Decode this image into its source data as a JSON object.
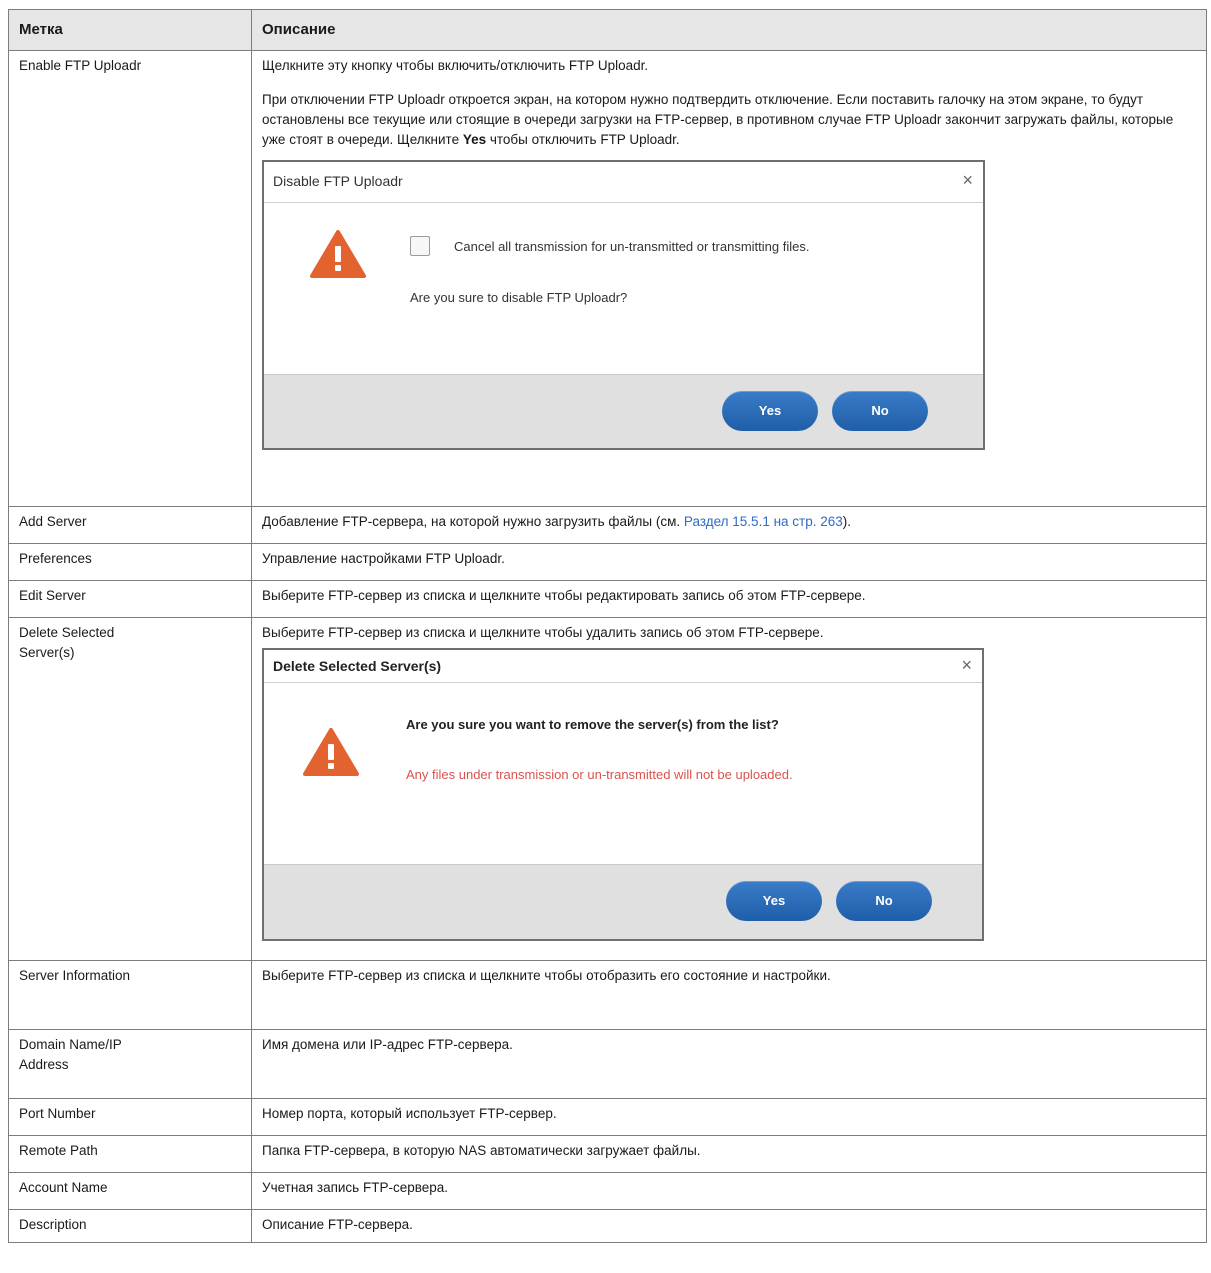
{
  "header": {
    "col_label": "Метка",
    "col_desc": "Описание"
  },
  "rows": {
    "enable": {
      "label": "Enable FTP Uploadr",
      "p1": "Щелкните эту кнопку чтобы включить/отключить  FTP Uploadr.",
      "p2_before": "При отключении FTP Uploadr откроется экран, на котором нужно подтвердить отключение. Если поставить галочку на этом экране, то будут остановлены все текущие или стоящие в очереди загрузки на FTP-сервер, в противном случае FTP Uploadr закончит загружать файлы, которые уже стоят в очереди. Щелкните ",
      "p2_bold": "Yes",
      "p2_after": " чтобы отключить FTP Uploadr."
    },
    "add": {
      "label": "Add Server",
      "text_before": "Добавление FTP-сервера, на которой нужно загрузить файлы (см. ",
      "link": "Раздел 15.5.1 на стр. 263",
      "text_after": ")."
    },
    "prefs": {
      "label": "Preferences",
      "text": "Управление настройками FTP Uploadr."
    },
    "edit": {
      "label": "Edit Server",
      "text": "Выберите FTP-сервер из списка и щелкните чтобы редактировать запись об этом FTP-сервере."
    },
    "delete": {
      "label": "Delete Selected Server(s)",
      "text": "Выберите FTP-сервер из списка и щелкните чтобы удалить запись об этом FTP-сервере."
    },
    "info": {
      "label": "Server Information",
      "text": "Выберите FTP-сервер из списка и щелкните чтобы отобразить его состояние и настройки."
    },
    "domain": {
      "label": "Domain Name/IP Address",
      "text": "Имя домена или IP-адрес FTP-сервера."
    },
    "port": {
      "label": "Port Number",
      "text": "Номер порта, который использует FTP-сервер."
    },
    "path": {
      "label": "Remote Path",
      "text": "Папка FTP-сервера, в которую NAS автоматически  загружает файлы."
    },
    "account": {
      "label": "Account Name",
      "text": "Учетная запись FTP-сервера."
    },
    "desc": {
      "label": "Description",
      "text": "Описание FTP-сервера."
    }
  },
  "dialog_disable": {
    "title": "Disable FTP Uploadr",
    "close": "×",
    "checkbox_label": "Cancel all transmission for un-transmitted or transmitting files.",
    "question": "Are you sure to disable FTP Uploadr?",
    "yes": "Yes",
    "no": "No",
    "icon": "warning-icon"
  },
  "dialog_delete": {
    "title": "Delete Selected Server(s)",
    "close": "×",
    "question": "Are you sure you want to remove the server(s) from the list?",
    "warning": "Any files under transmission or un-transmitted will not be uploaded.",
    "yes": "Yes",
    "no": "No",
    "icon": "warning-icon"
  },
  "colors": {
    "header_bg": "#e6e6e6",
    "link": "#2d6bc4",
    "warning_orange": "#e2632f",
    "warning_text_red": "#d9534f",
    "button_blue": "#2a6fbd"
  }
}
